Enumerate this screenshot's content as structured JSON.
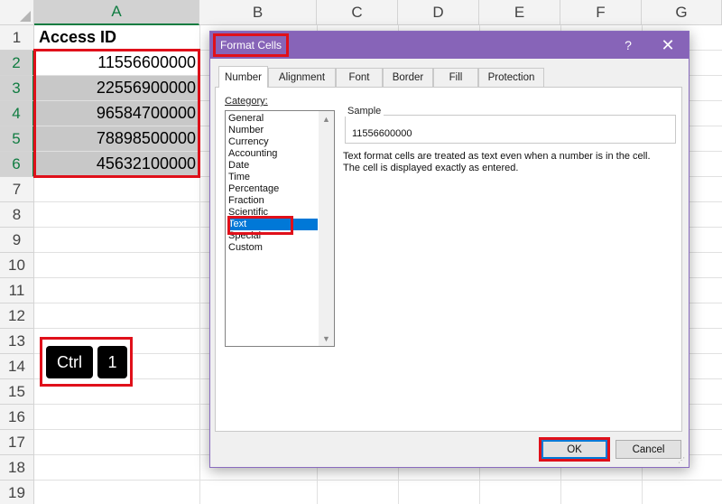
{
  "sheet": {
    "columns": [
      "A",
      "B",
      "C",
      "D",
      "E",
      "F",
      "G"
    ],
    "rows": [
      "1",
      "2",
      "3",
      "4",
      "5",
      "6",
      "7",
      "8",
      "9",
      "10",
      "11",
      "12",
      "13",
      "14",
      "15",
      "16",
      "17",
      "18",
      "19"
    ],
    "header_cell": "Access ID",
    "values": [
      "11556600000",
      "22556900000",
      "96584700000",
      "78898500000",
      "45632100000"
    ]
  },
  "shortcut": {
    "key1": "Ctrl",
    "key2": "1"
  },
  "dialog": {
    "title": "Format Cells",
    "help": "?",
    "close": "✕",
    "tabs": [
      "Number",
      "Alignment",
      "Font",
      "Border",
      "Fill",
      "Protection"
    ],
    "active_tab": "Number",
    "category_label": "Category:",
    "categories": [
      "General",
      "Number",
      "Currency",
      "Accounting",
      "Date",
      "Time",
      "Percentage",
      "Fraction",
      "Scientific",
      "Text",
      "Special",
      "Custom"
    ],
    "selected_category": "Text",
    "sample_label": "Sample",
    "sample_value": "11556600000",
    "description_line1": "Text format cells are treated as text even when a number is in the cell.",
    "description_line2": "The cell is displayed exactly as entered.",
    "ok": "OK",
    "cancel": "Cancel"
  },
  "colors": {
    "titlebar": "#8764b8",
    "highlight": "#e0101a",
    "selection": "#0078d7",
    "excel_green": "#107c41"
  },
  "icons": {
    "help": "question-icon",
    "close": "close-icon",
    "scroll_up": "chevron-up-icon",
    "scroll_down": "chevron-down-icon"
  }
}
